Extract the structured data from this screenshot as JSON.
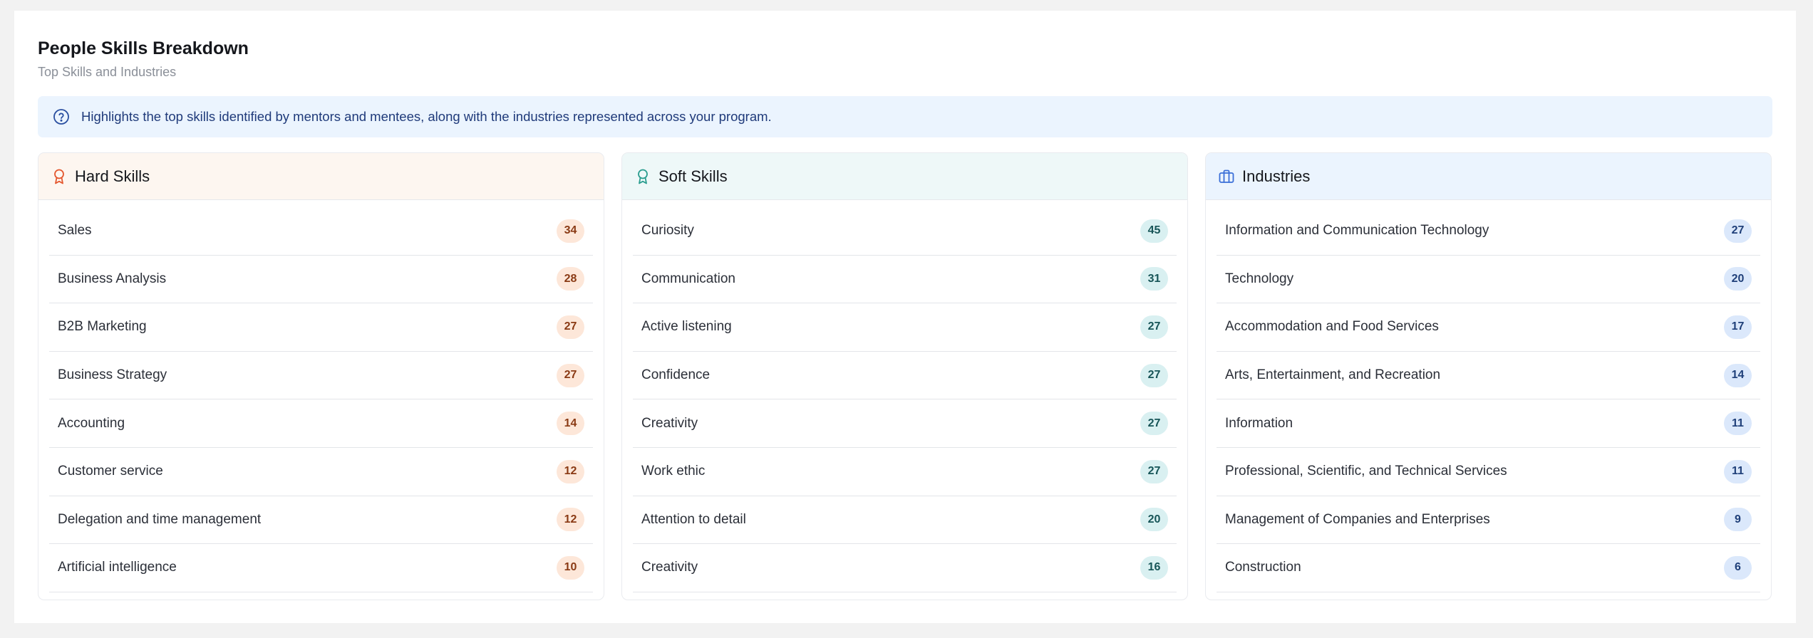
{
  "header": {
    "title": "People Skills Breakdown",
    "subtitle": "Top Skills and Industries"
  },
  "info": {
    "icon": "question-circle-icon",
    "text": "Highlights the top skills identified by mentors and mentees, along with the industries represented across your program."
  },
  "colors": {
    "hard_accent": "#e4572e",
    "soft_accent": "#2a9d8f",
    "industries_accent": "#3b6fd8"
  },
  "cards": [
    {
      "key": "hard",
      "title": "Hard Skills",
      "icon": "award-ribbon-icon",
      "items": [
        {
          "label": "Sales",
          "count": "34"
        },
        {
          "label": "Business Analysis",
          "count": "28"
        },
        {
          "label": "B2B Marketing",
          "count": "27"
        },
        {
          "label": "Business Strategy",
          "count": "27"
        },
        {
          "label": "Accounting",
          "count": "14"
        },
        {
          "label": "Customer service",
          "count": "12"
        },
        {
          "label": "Delegation and time management",
          "count": "12"
        },
        {
          "label": "Artificial intelligence",
          "count": "10"
        }
      ]
    },
    {
      "key": "soft",
      "title": "Soft Skills",
      "icon": "award-ribbon-icon",
      "items": [
        {
          "label": "Curiosity",
          "count": "45"
        },
        {
          "label": "Communication",
          "count": "31"
        },
        {
          "label": "Active listening",
          "count": "27"
        },
        {
          "label": "Confidence",
          "count": "27"
        },
        {
          "label": "Creativity",
          "count": "27"
        },
        {
          "label": "Work ethic",
          "count": "27"
        },
        {
          "label": "Attention to detail",
          "count": "20"
        },
        {
          "label": "Creativity",
          "count": "16"
        }
      ]
    },
    {
      "key": "ind",
      "title": "Industries",
      "icon": "briefcase-icon",
      "items": [
        {
          "label": "Information and Communication Technology",
          "count": "27"
        },
        {
          "label": "Technology",
          "count": "20"
        },
        {
          "label": "Accommodation and Food Services",
          "count": "17"
        },
        {
          "label": "Arts, Entertainment, and Recreation",
          "count": "14"
        },
        {
          "label": "Information",
          "count": "11"
        },
        {
          "label": "Professional, Scientific, and Technical Services",
          "count": "11"
        },
        {
          "label": "Management of Companies and Enterprises",
          "count": "9"
        },
        {
          "label": "Construction",
          "count": "6"
        }
      ]
    }
  ]
}
